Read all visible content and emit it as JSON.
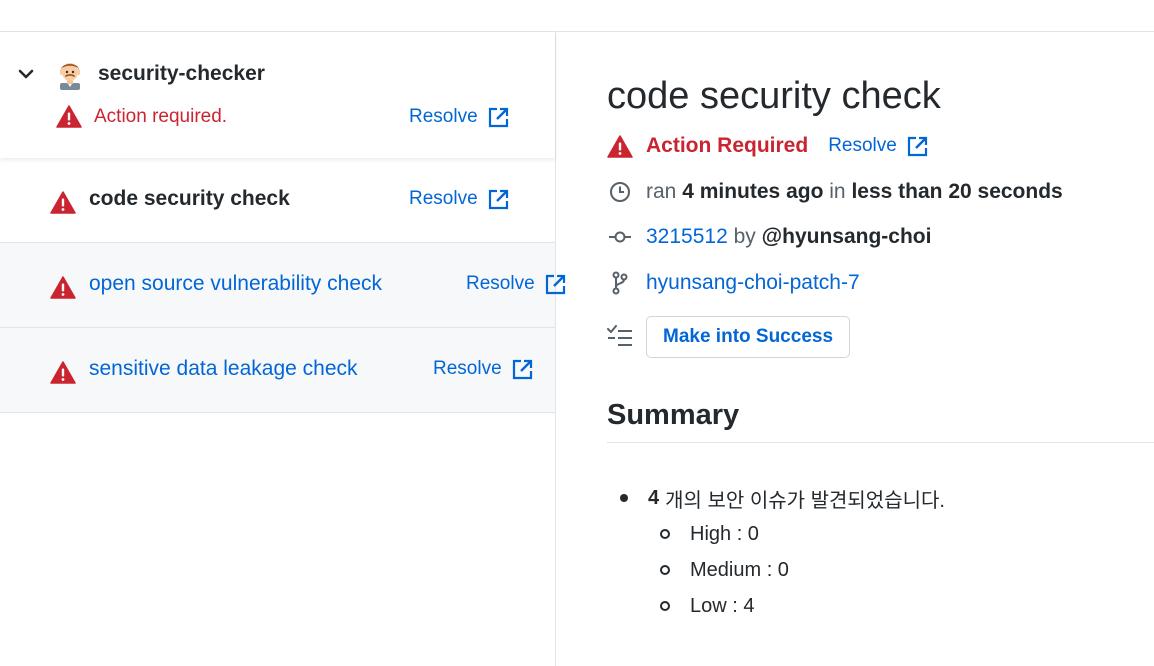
{
  "suite": {
    "app_name": "security-checker",
    "status_text": "Action required.",
    "resolve_label": "Resolve"
  },
  "runs": [
    {
      "name": "code security check",
      "resolve_label": "Resolve"
    },
    {
      "name": "open source vulnerability check",
      "resolve_label": "Resolve"
    },
    {
      "name": "sensitive data leakage check",
      "resolve_label": "Resolve"
    }
  ],
  "detail": {
    "title": "code security check",
    "status_text": "Action Required",
    "resolve_label": "Resolve",
    "ran_prefix": "ran",
    "ran_ago": "4 minutes ago",
    "ran_in": "in",
    "duration": "less than 20 seconds",
    "commit_sha": "3215512",
    "by_word": "by",
    "author": "@hyunsang-choi",
    "branch": "hyunsang-choi-patch-7",
    "action_button": "Make into Success",
    "summary_heading": "Summary",
    "summary": {
      "count": "4",
      "text": "개의 보안 이슈가 발견되었습니다.",
      "items": [
        "High : 0",
        "Medium : 0",
        "Low : 4"
      ]
    }
  },
  "colors": {
    "error": "#cb2431",
    "link": "#0366d6",
    "text": "#24292e",
    "muted": "#586069",
    "border": "#e1e4e8"
  },
  "icons": {
    "chevron": "chevron-down-icon",
    "warning": "alert-icon",
    "external": "external-link-icon",
    "clock": "clock-icon",
    "commit": "git-commit-icon",
    "branch": "git-branch-icon",
    "tasklist": "tasklist-icon"
  }
}
